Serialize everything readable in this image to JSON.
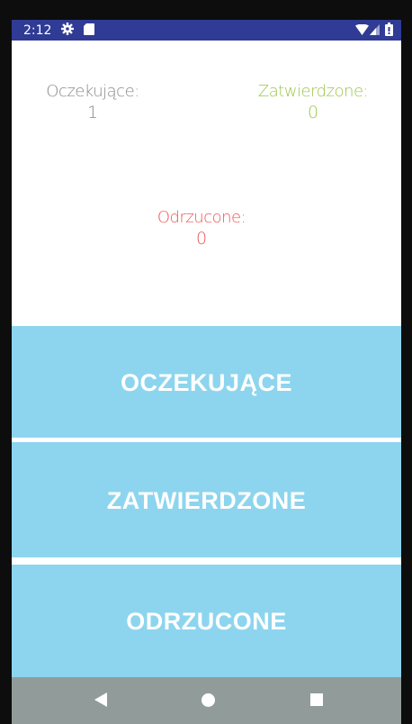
{
  "status_bar": {
    "time": "2:12",
    "icons": [
      "gear-icon",
      "sd-card-icon",
      "wifi-icon",
      "signal-icon",
      "battery-icon"
    ],
    "background": "#2f3b95"
  },
  "stats": {
    "pending": {
      "label": "Oczekujące:",
      "value": "1",
      "color": "#8a8a8a"
    },
    "approved": {
      "label": "Zatwierdzone:",
      "value": "0",
      "color": "#9cc84a"
    },
    "rejected": {
      "label": "Odrzucone:",
      "value": "0",
      "color": "#ee5656"
    }
  },
  "buttons": {
    "pending_label": "OCZEKUJĄCE",
    "approved_label": "ZATWIERDZONE",
    "rejected_label": "ODRZUCONE",
    "background": "#8dd5ee",
    "text_color": "#ffffff"
  },
  "nav_bar": {
    "icons": [
      "back-icon",
      "home-icon",
      "recents-icon"
    ],
    "background": "#919c9a"
  }
}
